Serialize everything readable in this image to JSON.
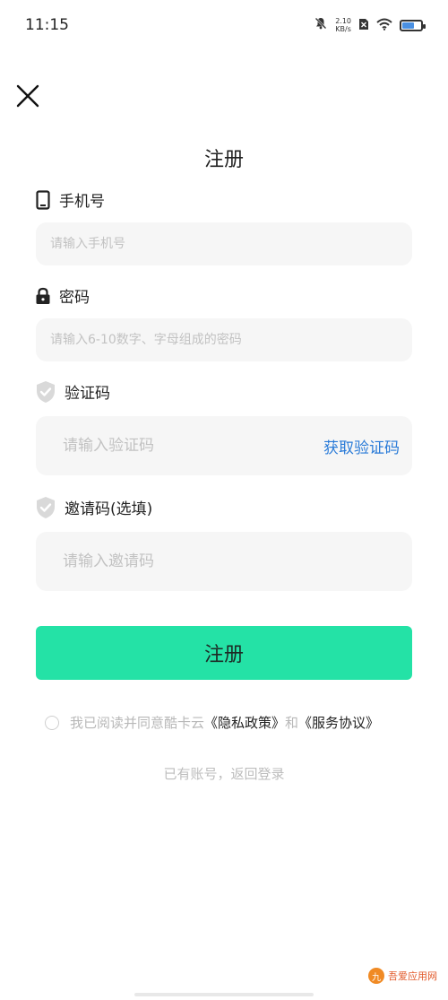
{
  "status_bar": {
    "time": "11:15",
    "net_speed_value": "2.10",
    "net_speed_unit": "KB/s",
    "battery_level": 0.6,
    "icons": [
      "mute-bell-icon",
      "sim-icon",
      "wifi-icon",
      "battery-icon"
    ]
  },
  "header": {
    "close_icon": "close-icon",
    "title": "注册"
  },
  "phone": {
    "label": "手机号",
    "icon": "phone-icon",
    "placeholder": "请输入手机号",
    "value": ""
  },
  "password": {
    "label": "密码",
    "icon": "lock-icon",
    "placeholder": "请输入6-10数字、字母组成的密码",
    "value": ""
  },
  "verification": {
    "label": "验证码",
    "icon": "shield-check-icon",
    "placeholder": "请输入验证码",
    "value": "",
    "get_code_label": "获取验证码"
  },
  "invite": {
    "label": "邀请码(选填)",
    "icon": "shield-check-icon",
    "placeholder": "请输入邀请码",
    "value": ""
  },
  "submit_label": "注册",
  "agreement": {
    "prefix": "我已阅读并同意酷卡云",
    "privacy_link": "《隐私政策》",
    "joiner": "和",
    "service_link": "《服务协议》"
  },
  "login_link": "已有账号，返回登录",
  "watermark": {
    "badge": "九",
    "text": "吾爱应用网"
  },
  "colors": {
    "accent_green": "#24e2a6",
    "link_blue": "#2a7bd8",
    "input_bg": "#f6f6f6",
    "placeholder": "#c2c2c2"
  }
}
